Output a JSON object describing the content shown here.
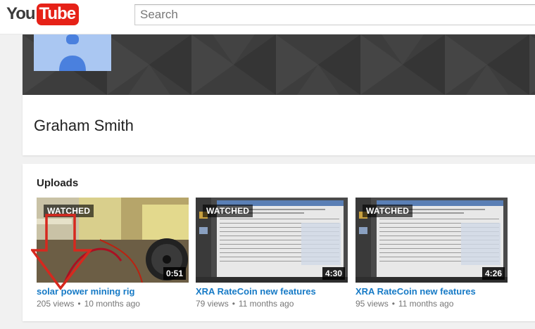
{
  "header": {
    "logo_you": "You",
    "logo_tube": "Tube",
    "search_placeholder": "Search"
  },
  "channel": {
    "name": "Graham Smith"
  },
  "uploads": {
    "title": "Uploads",
    "videos": [
      {
        "badge": "WATCHED",
        "duration": "0:51",
        "title": "solar power mining rig",
        "views": "205 views",
        "age": "10 months ago"
      },
      {
        "badge": "WATCHED",
        "duration": "4:30",
        "title": "XRA RateCoin new features",
        "views": "79 views",
        "age": "11 months ago"
      },
      {
        "badge": "WATCHED",
        "duration": "4:26",
        "title": "XRA RateCoin new features",
        "views": "95 views",
        "age": "11 months ago"
      }
    ],
    "meta_separator": "•"
  },
  "colors": {
    "brand_red": "#e62117",
    "link_blue": "#167ac6",
    "annotation_red": "#d6281e"
  },
  "icons": {
    "avatar": "default-user-avatar",
    "annotation": "red-down-arrow"
  }
}
